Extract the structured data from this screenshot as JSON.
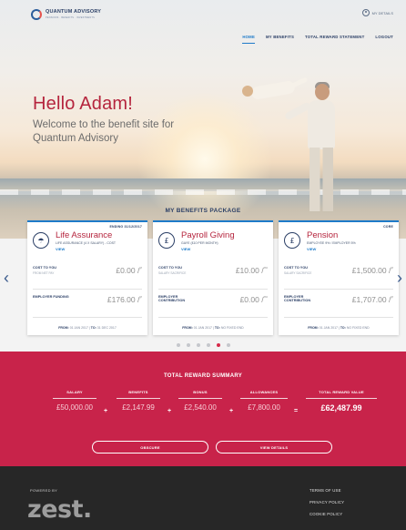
{
  "header": {
    "logo_name": "QUANTUM ADVISORY",
    "logo_tagline": "PENSIONS · BENEFITS · INVESTMENTS",
    "my_details": "MY DETAILS",
    "nav": [
      "HOME",
      "MY BENEFITS",
      "TOTAL REWARD STATEMENT",
      "LOGOUT"
    ],
    "active_nav": "HOME",
    "colors": {
      "brand_blue": "#1e7bc9",
      "brand_red": "#b5243d"
    }
  },
  "hero": {
    "greeting": "Hello Adam!",
    "welcome": "Welcome to the benefit site for Quantum Advisory"
  },
  "benefits": {
    "title": "MY BENEFITS PACKAGE",
    "cards": [
      {
        "badge": "ENDING 31/12/2017",
        "icon": "umbrella-icon",
        "name": "Life Assurance",
        "desc": "LIFE ASSURANCE (4 X SALARY) - COST",
        "view": "VIEW",
        "row1_label": "COST TO YOU",
        "row1_sub": "FROM NET PAY",
        "row1_value": "£0.00 /",
        "row1_suffix": "yr",
        "row2_label": "EMPLOYER FUNDING",
        "row2_sub": "",
        "row2_value": "£176.00 /",
        "row2_suffix": "yr",
        "from_label": "FROM:",
        "from": "01 JAN 2017",
        "to_label": "TO:",
        "to": "31 DEC 2017"
      },
      {
        "badge": "",
        "icon": "pound-circle-icon",
        "name": "Payroll Giving",
        "desc": "GAYE (£10 PER MONTH)",
        "view": "VIEW",
        "row1_label": "COST TO YOU",
        "row1_sub": "SALARY SACRIFICE",
        "row1_value": "£10.00 /",
        "row1_suffix": "mo",
        "row2_label": "EMPLOYER CONTRIBUTION",
        "row2_sub": "",
        "row2_value": "£0.00 /",
        "row2_suffix": "mo",
        "from_label": "FROM:",
        "from": "01 JAN 2017",
        "to_label": "TO:",
        "to": "NO FIXED END"
      },
      {
        "badge": "CORE",
        "icon": "pound-circle-icon",
        "name": "Pension",
        "desc": "EMPLOYEE 9% / EMPLOYER 5%",
        "view": "VIEW",
        "row1_label": "COST TO YOU",
        "row1_sub": "SALARY SACRIFICE",
        "row1_value": "£1,500.00 /",
        "row1_suffix": "yr",
        "row2_label": "EMPLOYER CONTRIBUTION",
        "row2_sub": "",
        "row2_value": "£1,707.00 /",
        "row2_suffix": "yr",
        "from_label": "FROM:",
        "from": "01 JAN 2017",
        "to_label": "TO:",
        "to": "NO FIXED END"
      }
    ],
    "carousel_dots": 6,
    "active_dot": 4
  },
  "reward": {
    "title": "TOTAL REWARD SUMMARY",
    "columns": [
      {
        "label": "SALARY",
        "value": "£50,000.00"
      },
      {
        "label": "BENEFITS",
        "value": "£2,147.99"
      },
      {
        "label": "BONUS",
        "value": "£2,540.00"
      },
      {
        "label": "ALLOWANCES",
        "value": "£7,800.00"
      },
      {
        "label": "TOTAL REWARD VALUE",
        "value": "£62,487.99"
      }
    ],
    "ops": [
      "+",
      "+",
      "+",
      "="
    ],
    "obscure": "OBSCURE",
    "view_details": "VIEW DETAILS"
  },
  "footer": {
    "powered_by": "POWERED BY",
    "brand": "zest.",
    "links": [
      "TERMS OF USE",
      "PRIVACY POLICY",
      "COOKIE POLICY"
    ]
  }
}
